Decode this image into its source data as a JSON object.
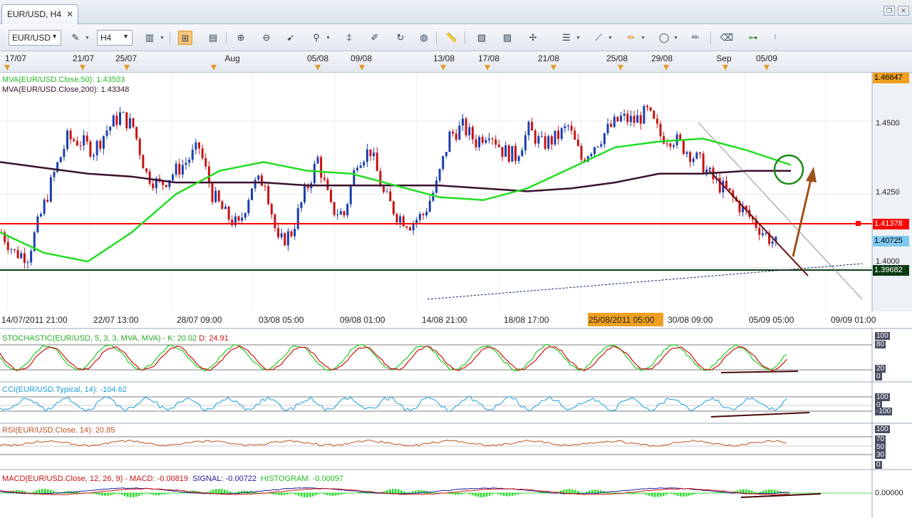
{
  "tab": {
    "title": "EUR/USD, H4"
  },
  "toolbar": {
    "symbol": "EUR/USD",
    "timeframe": "H4"
  },
  "date_scale": {
    "labels": [
      "17/07",
      "21/07",
      "25/07",
      "Aug",
      "05/08",
      "09/08",
      "13/08",
      "17/08",
      "21/08",
      "25/08",
      "29/08",
      "Sep",
      "05/09"
    ]
  },
  "main_chart": {
    "mva50_legend": "MVA(EUR/USD.Close,50): 1.43503",
    "mva200_legend": "MVA(EUR/USD.Close,200): 1.43348",
    "price_labels": [
      "1.4500",
      "1.4250",
      "1.4000"
    ],
    "tags": {
      "top": "1.46647",
      "resistance": "1.41378",
      "current": "1.40725",
      "support": "1.39682"
    },
    "time_labels": [
      "14/07/2011 21:00",
      "22/07 13:00",
      "28/07 09:00",
      "03/08 05:00",
      "09/08 01:00",
      "14/08 21:00",
      "18/08 17:00",
      "25/08/2011 05:00",
      "30/08 09:00",
      "05/09 05:00",
      "09/09 01:00"
    ],
    "colors": {
      "mva50": "#22dd22",
      "mva200": "#3b1230",
      "resistance": "#ff0000",
      "support": "#0b3b12",
      "arrow": "#a0521c"
    }
  },
  "indicators": {
    "stoch": {
      "legend_a": "STOCHASTIC(EUR/USD, 5, 3, 3, MVA, MVA) -  K: 20.02",
      "legend_b": "D: 24.91",
      "scale": [
        "100",
        "80",
        "20",
        "0"
      ]
    },
    "cci": {
      "legend": "CCI(EUR/USD.Typical, 14): -104.62",
      "scale": [
        "100",
        "0",
        "-100"
      ]
    },
    "rsi": {
      "legend": "RSI(EUR/USD.Close, 14): 20.85",
      "scale": [
        "100",
        "70",
        "50",
        "30",
        "0"
      ]
    },
    "macd": {
      "legend_a": "MACD(EUR/USD.Close, 12, 26, 9) -  MACD: -0.00819",
      "legend_b": "SIGNAL: -0.00722",
      "legend_c": "HISTOGRAM: -0.00097",
      "scale": [
        "0.00000"
      ]
    }
  },
  "chart_data": {
    "type": "line",
    "title": "EUR/USD, H4",
    "symbol": "EUR/USD",
    "interval": "H4",
    "ylim": [
      1.385,
      1.4665
    ],
    "series": [
      {
        "name": "MVA(EUR/USD.Close,50)",
        "last": 1.43503,
        "values": [
          1.412,
          1.405,
          1.402,
          1.412,
          1.425,
          1.433,
          1.436,
          1.433,
          1.432,
          1.428,
          1.424,
          1.423,
          1.427,
          1.434,
          1.441,
          1.443,
          1.444,
          1.44,
          1.435
        ]
      },
      {
        "name": "MVA(EUR/USD.Close,200)",
        "last": 1.43348,
        "values": [
          1.436,
          1.434,
          1.432,
          1.431,
          1.429,
          1.429,
          1.429,
          1.428,
          1.428,
          1.428,
          1.428,
          1.427,
          1.426,
          1.427,
          1.429,
          1.432,
          1.432,
          1.433,
          1.433
        ]
      }
    ],
    "levels": {
      "top": 1.46647,
      "resistance": 1.41378,
      "current": 1.40725,
      "support": 1.39682
    }
  }
}
